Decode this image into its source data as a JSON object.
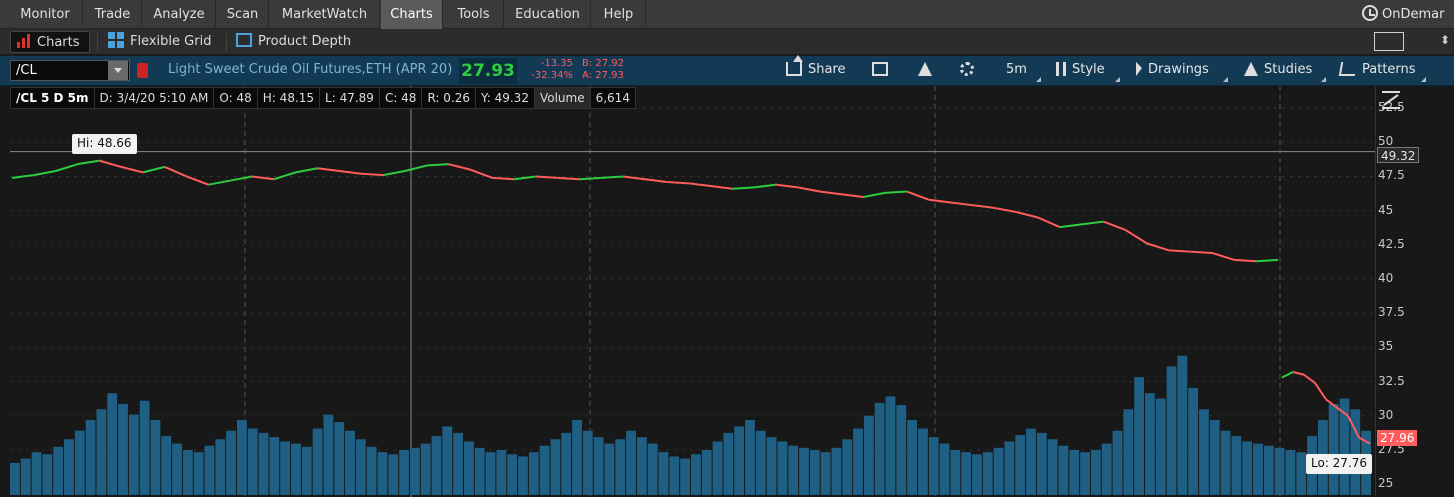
{
  "menu": {
    "items": [
      "Monitor",
      "Trade",
      "Analyze",
      "Scan",
      "MarketWatch",
      "Charts",
      "Tools",
      "Education",
      "Help"
    ],
    "active": "Charts",
    "ondemand": "OnDemar"
  },
  "subbar": {
    "charts_label": "Charts",
    "flexible_grid_label": "Flexible Grid",
    "product_depth_label": "Product Depth"
  },
  "symbol_bar": {
    "symbol": "/CL",
    "description": "Light Sweet Crude Oil Futures,ETH (APR 20)",
    "last": "27.93",
    "net_change": "-13.35",
    "pct_change": "-32.34%",
    "bid": "B: 27.92",
    "ask": "A: 27.93",
    "share_label": "Share",
    "timeframe_label": "5m",
    "style_label": "Style",
    "drawings_label": "Drawings",
    "studies_label": "Studies",
    "patterns_label": "Patterns"
  },
  "info_bar": {
    "symbol_period": "/CL 5 D 5m",
    "date": "D: 3/4/20 5:10 AM",
    "open": "O: 48",
    "high": "H: 48.15",
    "low": "L: 47.89",
    "close": "C: 48",
    "range": "R: 0.26",
    "y_value": "Y: 49.32",
    "volume_label": "Volume",
    "volume_value": "6,614"
  },
  "chart_data": {
    "type": "line",
    "y_ticks": [
      "52.5",
      "50",
      "47.5",
      "45",
      "42.5",
      "40",
      "37.5",
      "35",
      "32.5",
      "30",
      "27.5",
      "25"
    ],
    "ylim": [
      24.5,
      52.8
    ],
    "crosshair_price": "49.32",
    "last_price_tag": "27.96",
    "high_label": "Hi: 48.66",
    "low_label": "Lo: 27.76",
    "series": [
      {
        "values": [
          47.4,
          47.6,
          47.9,
          48.4,
          48.66,
          48.2,
          47.8,
          48.2,
          47.5,
          46.9,
          47.2,
          47.5,
          47.3,
          47.8,
          48.1,
          47.9,
          47.7,
          47.6,
          47.9,
          48.3,
          48.4,
          48.0,
          47.4,
          47.3,
          47.5,
          47.4,
          47.3,
          47.4,
          47.5,
          47.3,
          47.1,
          47.0,
          46.8,
          46.6,
          46.7,
          46.9,
          46.7,
          46.4,
          46.2,
          46.0,
          46.3,
          46.4,
          45.8,
          45.6,
          45.4,
          45.2,
          44.9,
          44.5,
          43.8,
          44.0,
          44.2,
          43.6,
          42.6,
          42.1,
          42.0,
          41.9,
          41.4,
          41.3,
          41.4,
          32.8,
          33.2,
          33.0,
          32.4,
          31.2,
          30.6,
          30.0,
          28.4,
          27.96
        ]
      }
    ]
  },
  "volume_data": {
    "values": [
      30,
      34,
      40,
      38,
      45,
      52,
      60,
      70,
      80,
      95,
      85,
      75,
      88,
      70,
      55,
      48,
      42,
      40,
      46,
      52,
      60,
      70,
      62,
      58,
      54,
      50,
      48,
      45,
      62,
      75,
      68,
      60,
      52,
      45,
      40,
      38,
      42,
      44,
      48,
      55,
      64,
      58,
      50,
      44,
      40,
      42,
      38,
      36,
      40,
      46,
      52,
      58,
      70,
      60,
      54,
      48,
      52,
      60,
      54,
      48,
      40,
      36,
      34,
      38,
      42,
      50,
      58,
      64,
      70,
      60,
      54,
      50,
      46,
      44,
      42,
      40,
      44,
      52,
      62,
      74,
      86,
      92,
      84,
      70,
      62,
      54,
      48,
      42,
      40,
      38,
      40,
      44,
      50,
      56,
      62,
      58,
      52,
      46,
      42,
      40,
      42,
      48,
      60,
      80,
      110,
      95,
      90,
      120,
      130,
      100,
      80,
      70,
      60,
      55,
      50,
      48,
      46,
      44,
      42,
      40,
      55,
      70,
      85,
      90,
      80,
      60
    ]
  },
  "colors": {
    "up": "#2ecc40",
    "down": "#ff5c5c",
    "volume": "#1f5f84",
    "grid": "#3a3a3a",
    "symbol_bar_bg": "#123a55"
  }
}
